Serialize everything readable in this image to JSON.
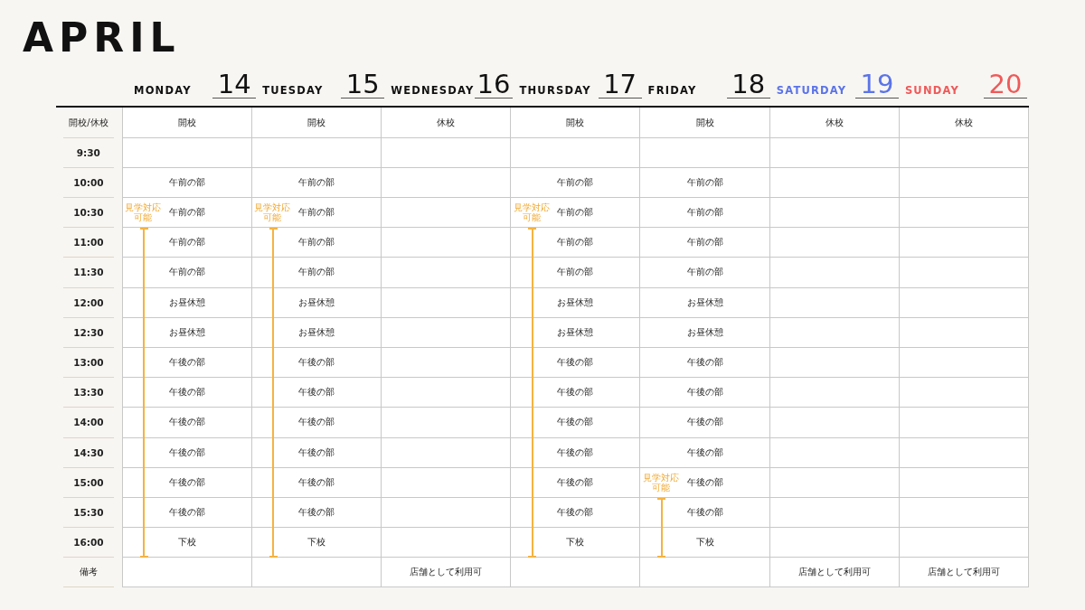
{
  "title": "APRIL",
  "row_labels": [
    {
      "text": "開校/休校",
      "kind": "status"
    },
    {
      "text": "9:30",
      "kind": "time"
    },
    {
      "text": "10:00",
      "kind": "time"
    },
    {
      "text": "10:30",
      "kind": "time"
    },
    {
      "text": "11:00",
      "kind": "time"
    },
    {
      "text": "11:30",
      "kind": "time"
    },
    {
      "text": "12:00",
      "kind": "time"
    },
    {
      "text": "12:30",
      "kind": "time"
    },
    {
      "text": "13:00",
      "kind": "time"
    },
    {
      "text": "13:30",
      "kind": "time"
    },
    {
      "text": "14:00",
      "kind": "time"
    },
    {
      "text": "14:30",
      "kind": "time"
    },
    {
      "text": "15:00",
      "kind": "time"
    },
    {
      "text": "15:30",
      "kind": "time"
    },
    {
      "text": "16:00",
      "kind": "time"
    },
    {
      "text": "備考",
      "kind": "note"
    }
  ],
  "days": [
    {
      "name": "MONDAY",
      "date": "14",
      "kind": "weekday",
      "cells": [
        {
          "text": "開校"
        },
        {},
        {
          "text": "午前の部"
        },
        {
          "text": "午前の部",
          "visit_note": "見学対応可能"
        },
        {
          "text": "午前の部",
          "visit_bar": true
        },
        {
          "text": "午前の部",
          "visit_bar": true
        },
        {
          "text": "お昼休憩",
          "visit_bar": true
        },
        {
          "text": "お昼休憩",
          "visit_bar": true
        },
        {
          "text": "午後の部",
          "visit_bar": true
        },
        {
          "text": "午後の部",
          "visit_bar": true
        },
        {
          "text": "午後の部",
          "visit_bar": true
        },
        {
          "text": "午後の部",
          "visit_bar": true
        },
        {
          "text": "午後の部",
          "visit_bar": true
        },
        {
          "text": "午後の部",
          "visit_bar": true
        },
        {
          "text": "下校",
          "visit_bar": true
        },
        {}
      ]
    },
    {
      "name": "TUESDAY",
      "date": "15",
      "kind": "weekday",
      "cells": [
        {
          "text": "開校"
        },
        {},
        {
          "text": "午前の部"
        },
        {
          "text": "午前の部",
          "visit_note": "見学対応可能"
        },
        {
          "text": "午前の部",
          "visit_bar": true
        },
        {
          "text": "午前の部",
          "visit_bar": true
        },
        {
          "text": "お昼休憩",
          "visit_bar": true
        },
        {
          "text": "お昼休憩",
          "visit_bar": true
        },
        {
          "text": "午後の部",
          "visit_bar": true
        },
        {
          "text": "午後の部",
          "visit_bar": true
        },
        {
          "text": "午後の部",
          "visit_bar": true
        },
        {
          "text": "午後の部",
          "visit_bar": true
        },
        {
          "text": "午後の部",
          "visit_bar": true
        },
        {
          "text": "午後の部",
          "visit_bar": true
        },
        {
          "text": "下校",
          "visit_bar": true
        },
        {}
      ]
    },
    {
      "name": "WEDNESDAY",
      "date": "16",
      "kind": "weekday",
      "cells": [
        {
          "text": "休校"
        },
        {},
        {},
        {},
        {},
        {},
        {},
        {},
        {},
        {},
        {},
        {},
        {},
        {},
        {},
        {
          "text": "店舗として利用可"
        }
      ]
    },
    {
      "name": "THURSDAY",
      "date": "17",
      "kind": "weekday",
      "cells": [
        {
          "text": "開校"
        },
        {},
        {
          "text": "午前の部"
        },
        {
          "text": "午前の部",
          "visit_note": "見学対応可能"
        },
        {
          "text": "午前の部",
          "visit_bar": true
        },
        {
          "text": "午前の部",
          "visit_bar": true
        },
        {
          "text": "お昼休憩",
          "visit_bar": true
        },
        {
          "text": "お昼休憩",
          "visit_bar": true
        },
        {
          "text": "午後の部",
          "visit_bar": true
        },
        {
          "text": "午後の部",
          "visit_bar": true
        },
        {
          "text": "午後の部",
          "visit_bar": true
        },
        {
          "text": "午後の部",
          "visit_bar": true
        },
        {
          "text": "午後の部",
          "visit_bar": true
        },
        {
          "text": "午後の部",
          "visit_bar": true
        },
        {
          "text": "下校",
          "visit_bar": true
        },
        {}
      ]
    },
    {
      "name": "FRIDAY",
      "date": "18",
      "kind": "weekday",
      "cells": [
        {
          "text": "開校"
        },
        {},
        {
          "text": "午前の部"
        },
        {
          "text": "午前の部"
        },
        {
          "text": "午前の部"
        },
        {
          "text": "午前の部"
        },
        {
          "text": "お昼休憩"
        },
        {
          "text": "お昼休憩"
        },
        {
          "text": "午後の部"
        },
        {
          "text": "午後の部"
        },
        {
          "text": "午後の部"
        },
        {
          "text": "午後の部"
        },
        {
          "text": "午後の部",
          "visit_note": "見学対応可能"
        },
        {
          "text": "午後の部",
          "visit_bar": true
        },
        {
          "text": "下校",
          "visit_bar": true
        },
        {}
      ]
    },
    {
      "name": "SATURDAY",
      "date": "19",
      "kind": "saturday",
      "cells": [
        {
          "text": "休校"
        },
        {},
        {},
        {},
        {},
        {},
        {},
        {},
        {},
        {},
        {},
        {},
        {},
        {},
        {},
        {
          "text": "店舗として利用可"
        }
      ]
    },
    {
      "name": "SUNDAY",
      "date": "20",
      "kind": "sunday",
      "cells": [
        {
          "text": "休校"
        },
        {},
        {},
        {},
        {},
        {},
        {},
        {},
        {},
        {},
        {},
        {},
        {},
        {},
        {},
        {
          "text": "店舗として利用可"
        }
      ]
    }
  ]
}
